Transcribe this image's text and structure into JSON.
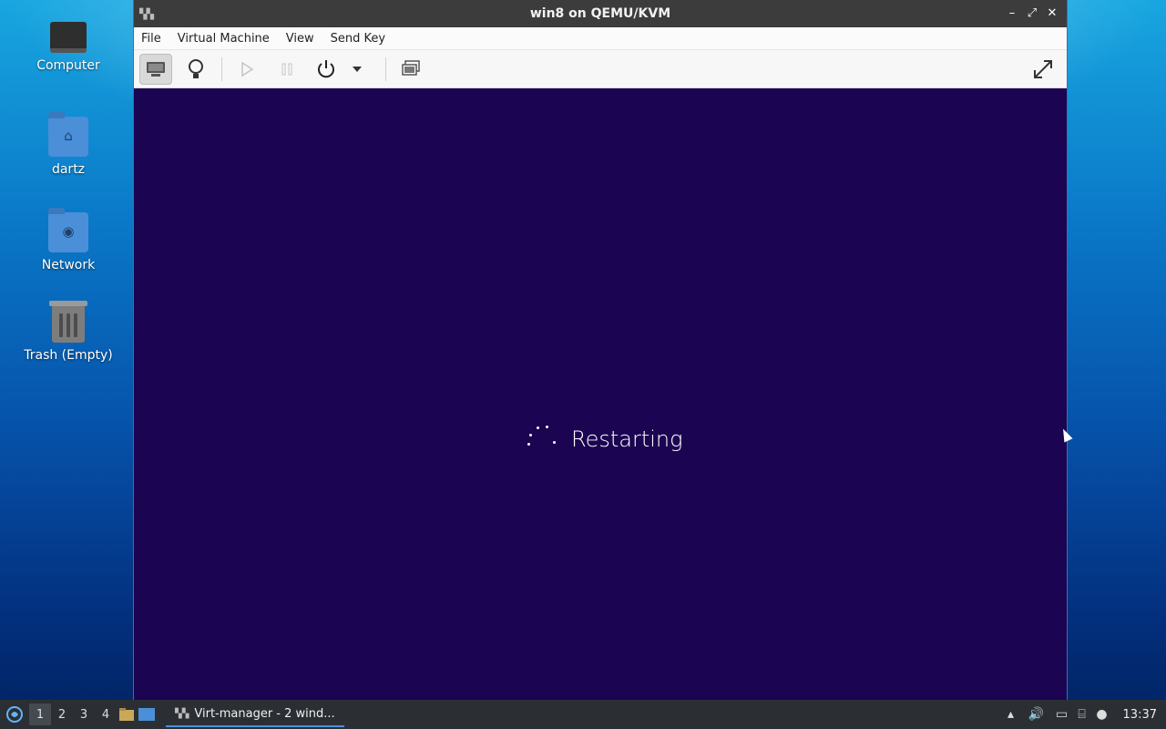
{
  "desktop": {
    "icons": [
      {
        "label": "Computer"
      },
      {
        "label": "dartz"
      },
      {
        "label": "Network"
      },
      {
        "label": "Trash (Empty)"
      }
    ]
  },
  "window": {
    "title": "win8 on QEMU/KVM",
    "menu": [
      "File",
      "Virtual Machine",
      "View",
      "Send Key"
    ],
    "guest_status_text": "Restarting",
    "guest_bg_color": "#1b0451"
  },
  "taskbar": {
    "workspaces": [
      "1",
      "2",
      "3",
      "4"
    ],
    "active_workspace": "1",
    "task_label": "Virt-manager - 2 wind...",
    "clock": "13:37"
  }
}
